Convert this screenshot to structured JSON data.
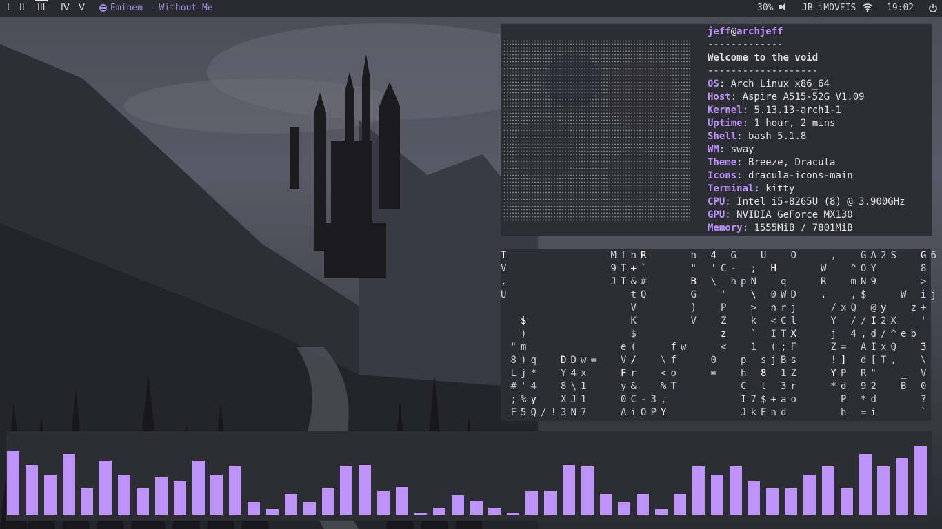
{
  "topbar": {
    "workspaces": [
      "I",
      "II",
      "III",
      "IV",
      "V"
    ],
    "active_workspace": "III",
    "now_playing": "Eminem - Without Me",
    "battery": "30%",
    "wifi": "JB_iMOVEIS",
    "clock": "19:02"
  },
  "neofetch": {
    "user": "jeff",
    "at": "@",
    "host": "archjeff",
    "separator1": "-------------",
    "welcome": "Welcome to the void",
    "separator2": "-------------------",
    "rows": [
      {
        "key": "OS",
        "value": "Arch Linux x86_64"
      },
      {
        "key": "Host",
        "value": "Aspire A515-52G V1.09"
      },
      {
        "key": "Kernel",
        "value": "5.13.13-arch1-1"
      },
      {
        "key": "Uptime",
        "value": "1 hour, 2 mins"
      },
      {
        "key": "Shell",
        "value": "bash 5.1.8"
      },
      {
        "key": "WM",
        "value": "sway"
      },
      {
        "key": "Theme",
        "value": "Breeze, Dracula"
      },
      {
        "key": "Icons",
        "value": "dracula-icons-main"
      },
      {
        "key": "Terminal",
        "value": "kitty"
      },
      {
        "key": "CPU",
        "value": "Intel i5-8265U (8) @ 3.900GHz"
      },
      {
        "key": "GPU",
        "value": "NVIDIA GeForce MX130"
      },
      {
        "key": "Memory",
        "value": "1555MiB / 7801MiB"
      }
    ]
  },
  "matrix_rows": [
    "T          MfhR    h 4 G  U  O   ,  GA2S  G6",
    "V          9T+`    \" 'C- ; H    W  ^OY    8",
    ",          JT&#    B \\_hpN  q   R  mN9    >",
    "U            tQ    G  '  \\ 0WD  .  ,$   W ij",
    "             V     )  P  > nrj   /xQ @y  z+",
    "  $          K     V  Z  k <Cl   Y //I2X _'",
    "  )          $        z  ` ITX   j 4,d/^eb",
    " \"m         e(   fw   <  1 (;F   Z= AIxQ  3",
    " 8)q  DDw=  V/  \\f   0  p sjBs   !] d[T,  \\",
    " Lj*  Y4x   Fr  <o   =  h 8 1Z   YP R\"  _ V",
    " #'4  8\\1   y&  %T      C t 3r   *d 92  B 0",
    " ;%y  XJ1   0C-3,       I7$+ao    P *d    ?",
    " F5Q/!3N7   AiOPY       JkEnd     h =i    `"
  ],
  "cava_levels": [
    92,
    72,
    58,
    88,
    38,
    78,
    58,
    38,
    54,
    48,
    78,
    58,
    70,
    18,
    8,
    30,
    18,
    38,
    70,
    72,
    34,
    40,
    2,
    10,
    28,
    20,
    10,
    2,
    34,
    34,
    72,
    70,
    30,
    18,
    30,
    8,
    30,
    70,
    58,
    70,
    48,
    38,
    38,
    58,
    70,
    38,
    88,
    70,
    82,
    100
  ],
  "colors": {
    "accent": "#bd93f9",
    "background": "#2d2d35",
    "bar": "#2a2a32"
  }
}
